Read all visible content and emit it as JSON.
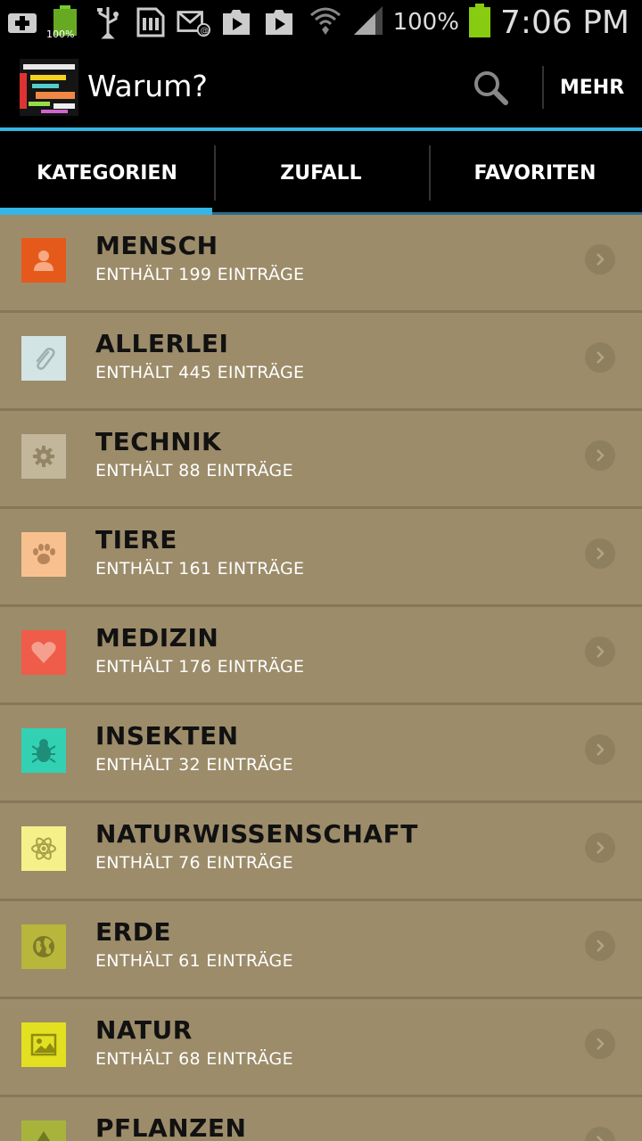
{
  "status_bar": {
    "battery_small_pct": "100%",
    "signal_pct": "100%",
    "time": "7:06 PM"
  },
  "action_bar": {
    "title": "Warum?",
    "more_label": "MEHR"
  },
  "tabs": [
    {
      "label": "KATEGORIEN",
      "selected": true
    },
    {
      "label": "ZUFALL",
      "selected": false
    },
    {
      "label": "FAVORITEN",
      "selected": false
    }
  ],
  "categories": [
    {
      "name": "MENSCH",
      "count": "ENTHÄLT 199 EINTRÄGE",
      "color": "#e55a1b",
      "icon": "person-icon"
    },
    {
      "name": "ALLERLEI",
      "count": "ENTHÄLT 445 EINTRÄGE",
      "color": "#d3e4e4",
      "icon": "paperclip-icon"
    },
    {
      "name": "TECHNIK",
      "count": "ENTHÄLT 88 EINTRÄGE",
      "color": "#c2b69b",
      "icon": "gear-icon"
    },
    {
      "name": "TIERE",
      "count": "ENTHÄLT 161 EINTRÄGE",
      "color": "#f9c08f",
      "icon": "paw-icon"
    },
    {
      "name": "MEDIZIN",
      "count": "ENTHÄLT 176 EINTRÄGE",
      "color": "#ef5c4a",
      "icon": "heart-icon"
    },
    {
      "name": "INSEKTEN",
      "count": "ENTHÄLT 32 EINTRÄGE",
      "color": "#33d1b4",
      "icon": "bug-icon"
    },
    {
      "name": "NATURWISSENSCHAFT",
      "count": "ENTHÄLT 76 EINTRÄGE",
      "color": "#f6f08a",
      "icon": "atom-icon"
    },
    {
      "name": "ERDE",
      "count": "ENTHÄLT 61 EINTRÄGE",
      "color": "#b9b63c",
      "icon": "globe-icon"
    },
    {
      "name": "NATUR",
      "count": "ENTHÄLT 68 EINTRÄGE",
      "color": "#e3e021",
      "icon": "picture-icon"
    },
    {
      "name": "PFLANZEN",
      "count": "",
      "color": "#a7b43c",
      "icon": "leaf-icon"
    }
  ]
}
